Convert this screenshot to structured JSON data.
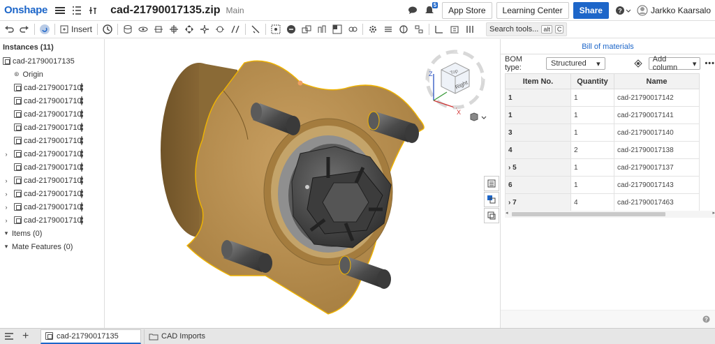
{
  "app": {
    "logo": "Onshape",
    "doc_title": "cad-21790017135.zip",
    "branch": "Main"
  },
  "header": {
    "notif_count": "5",
    "app_store": "App Store",
    "learning_center": "Learning Center",
    "share": "Share",
    "user": "Jarkko Kaarsalo"
  },
  "toolbar": {
    "insert_label": "Insert",
    "search_label": "Search tools...",
    "search_kbd1": "alt",
    "search_kbd2": "C"
  },
  "instances": {
    "title": "Instances (11)",
    "root": "cad-21790017135",
    "origin": "Origin",
    "items": [
      {
        "label": "cad-2179001710",
        "caret": ""
      },
      {
        "label": "cad-2179001710",
        "caret": ""
      },
      {
        "label": "cad-2179001710",
        "caret": ""
      },
      {
        "label": "cad-2179001710",
        "caret": ""
      },
      {
        "label": "cad-2179001710",
        "caret": ""
      },
      {
        "label": "cad-2179001710",
        "caret": "›"
      },
      {
        "label": "cad-2179001710",
        "caret": ""
      },
      {
        "label": "cad-2179001710",
        "caret": "›"
      },
      {
        "label": "cad-2179001710",
        "caret": "›"
      },
      {
        "label": "cad-2179001710",
        "caret": "›"
      },
      {
        "label": "cad-2179001710",
        "caret": "›"
      }
    ],
    "items_group": "Items (0)",
    "mate_features": "Mate Features (0)"
  },
  "viewcube": {
    "top": "Top",
    "right": "Right",
    "axis_x": "X",
    "axis_y": "Y",
    "axis_z": "Z"
  },
  "bom": {
    "title": "Bill of materials",
    "type_label": "BOM type:",
    "type_value": "Structured",
    "add_column": "Add column",
    "columns": [
      "Item No.",
      "Quantity",
      "Name"
    ],
    "rows": [
      {
        "item": "1",
        "qty": "1",
        "name": "cad-21790017142"
      },
      {
        "item": "1",
        "qty": "1",
        "name": "cad-21790017141"
      },
      {
        "item": "3",
        "qty": "1",
        "name": "cad-21790017140"
      },
      {
        "item": "4",
        "qty": "2",
        "name": "cad-21790017138"
      },
      {
        "item": "› 5",
        "qty": "1",
        "name": "cad-21790017137"
      },
      {
        "item": "6",
        "qty": "1",
        "name": "cad-21790017143"
      },
      {
        "item": "› 7",
        "qty": "4",
        "name": "cad-21790017463"
      }
    ]
  },
  "bottom_tabs": [
    {
      "label": "cad-21790017135"
    },
    {
      "label": "CAD Imports"
    }
  ],
  "colors": {
    "accent": "#1d66c9",
    "hub": "#b0894a",
    "selection": "#f0b400"
  }
}
